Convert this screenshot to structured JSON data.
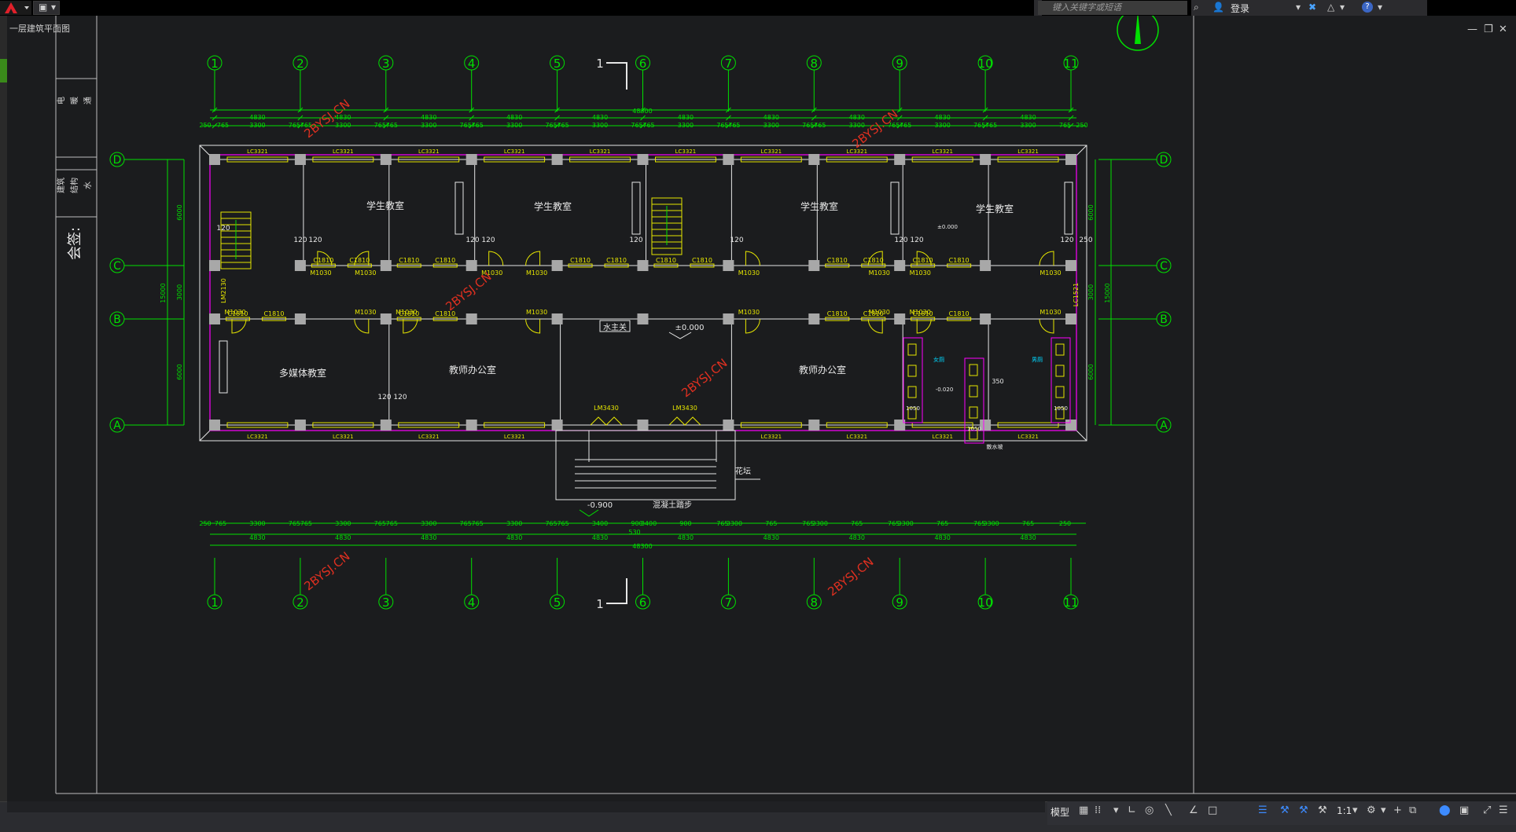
{
  "app": {
    "tab_title": "一层建筑平面图",
    "search_placeholder": "键入关键字或短语",
    "login_label": "登录"
  },
  "status": {
    "model_label": "模型",
    "scale_label": "1:1"
  },
  "title_block": {
    "disciplines_top": [
      "电",
      "暖",
      "通"
    ],
    "disciplines_bottom": [
      "建筑",
      "结构",
      "水"
    ],
    "sign_label": "会签:"
  },
  "plan": {
    "axis_numbers": [
      "1",
      "2",
      "3",
      "4",
      "5",
      "6",
      "7",
      "8",
      "9",
      "10",
      "11"
    ],
    "axis_letters": [
      "D",
      "C",
      "B",
      "A"
    ],
    "section_mark": "1",
    "top_dims_total": "48300",
    "top_dims_bays": [
      "4830",
      "4830",
      "4830",
      "4830",
      "4830",
      "4830",
      "4830",
      "4830",
      "4830",
      "4830"
    ],
    "top_dims_detail": [
      "250",
      "765",
      "3300",
      "765",
      "765",
      "3300",
      "765",
      "765",
      "3300",
      "765",
      "765",
      "3300",
      "765",
      "765",
      "3300",
      "765",
      "765",
      "3300",
      "765",
      "765",
      "3300",
      "765",
      "765",
      "3300",
      "765",
      "765",
      "3300",
      "765",
      "765",
      "3300",
      "765",
      "250"
    ],
    "bottom_dims_detail": [
      "250",
      "765",
      "3300",
      "765",
      "765",
      "3300",
      "765",
      "765",
      "3300",
      "765",
      "765",
      "3300",
      "765",
      "765",
      "3400",
      "900",
      "3400",
      "900",
      "765",
      "3300",
      "765",
      "765",
      "3300",
      "765",
      "765",
      "3300",
      "765",
      "765",
      "3300",
      "765",
      "250"
    ],
    "bottom_dims_total": "48300",
    "bottom_step_dim": "530",
    "left_dims": [
      "6000",
      "3000",
      "6000"
    ],
    "left_total": "15000",
    "right_dims": [
      "6000",
      "3000",
      "6000"
    ],
    "right_total": "15000",
    "window_top": "LC3321",
    "window_inner": "C1810",
    "door_inner": "M1030",
    "door_main": "LM3430",
    "door_side": "LM2130",
    "window_side": "LC1521",
    "rooms": {
      "student_classroom": "学生教室",
      "multimedia": "多媒体教室",
      "teacher_office": "教师办公室",
      "water_room": "水主关",
      "male_wc": "女厕",
      "female_wc": "男厕",
      "flower_bed": "花坛",
      "concrete_steps": "混凝土踏步",
      "drainage": "散水坡"
    },
    "levels": {
      "ground": "±0.000",
      "upper": "±0.000",
      "exterior": "-0.900",
      "wc": "-0.020"
    },
    "dim_120": "120",
    "dim_250": "250",
    "dim_1050": "1050",
    "dim_350": "350",
    "watermark": "2BYSJ.CN"
  },
  "colors": {
    "background": "#1b1c1e",
    "axis_green": "#00e000",
    "wall_white": "#e6e6e6",
    "window_yellow": "#e6e600",
    "magenta": "#ff00ff",
    "watermark_red": "#e03020"
  }
}
